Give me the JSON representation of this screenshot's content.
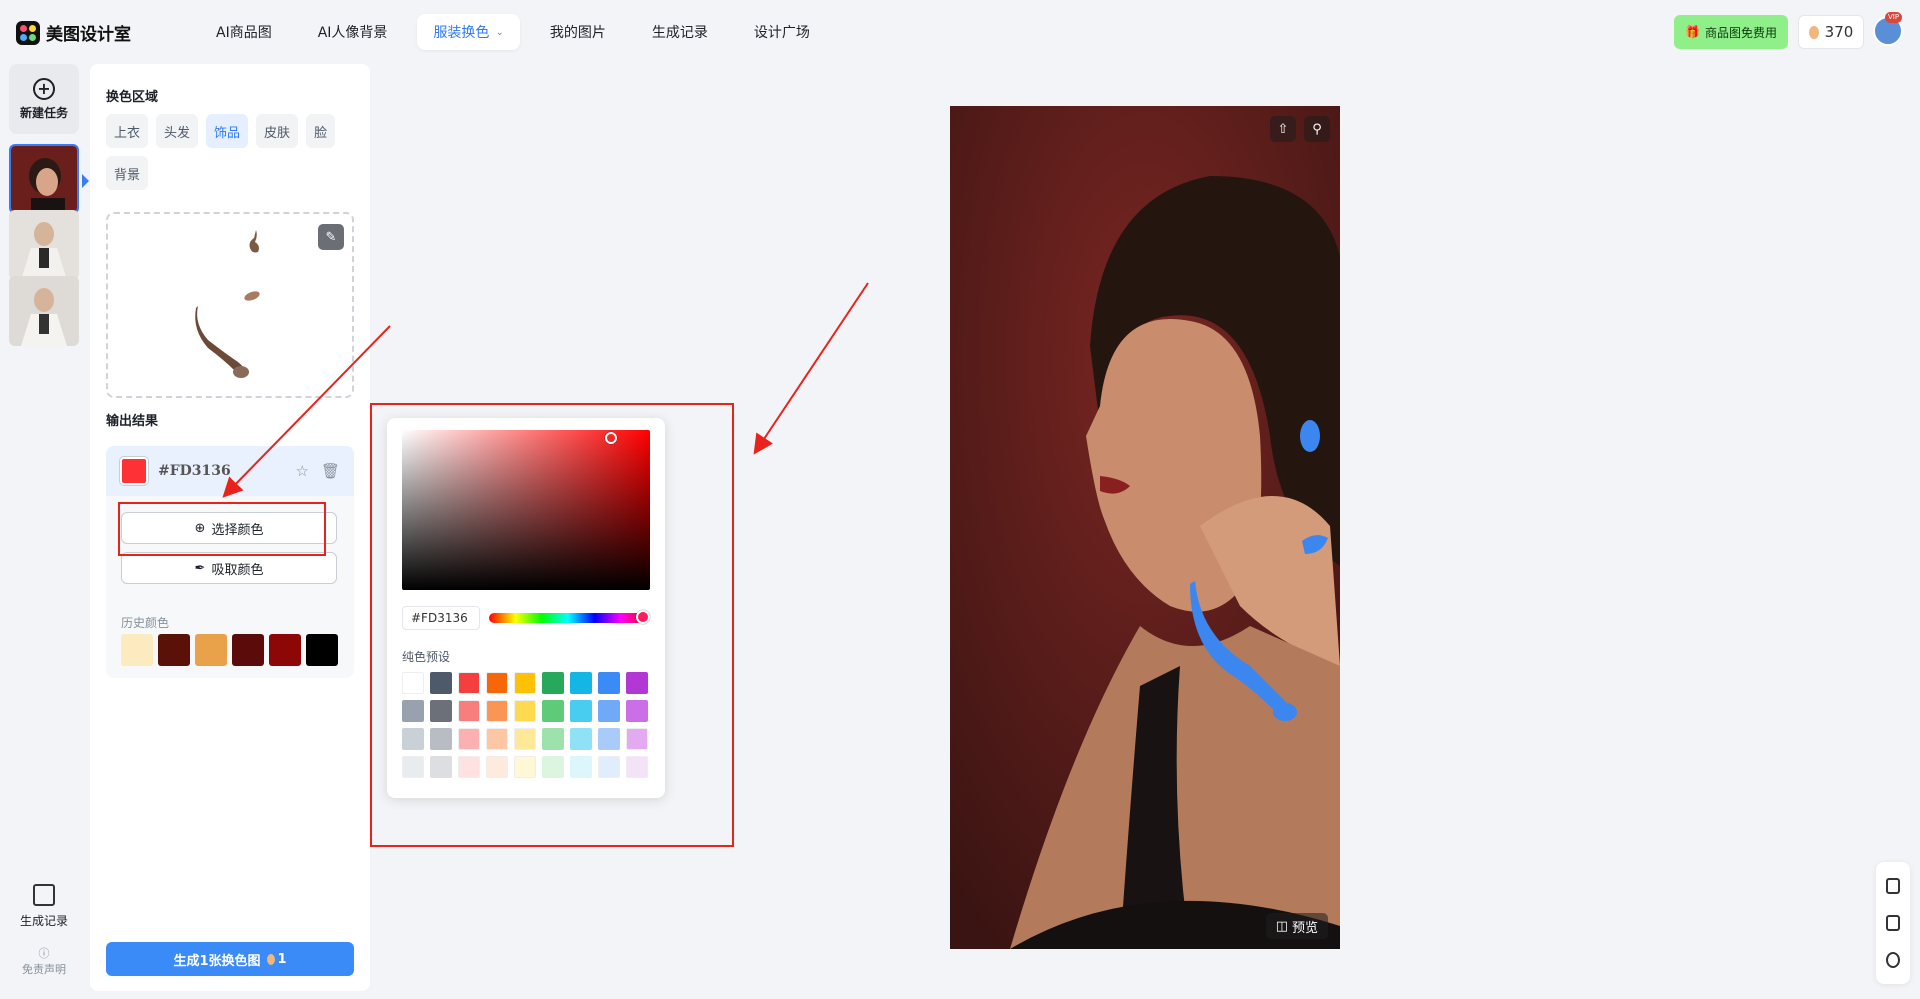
{
  "app": {
    "name": "美图设计室"
  },
  "nav": [
    {
      "label": "AI商品图"
    },
    {
      "label": "AI人像背景"
    },
    {
      "label": "服装换色",
      "active": true
    },
    {
      "label": "我的图片"
    },
    {
      "label": "生成记录"
    },
    {
      "label": "设计广场"
    }
  ],
  "topright": {
    "free_label": "商品图免费用",
    "credits": "370",
    "vip_badge": "VIP"
  },
  "rail": {
    "new_task": "新建任务",
    "history": "生成记录",
    "disclaimer": "免责声明"
  },
  "panel": {
    "region_title": "换色区域",
    "regions": [
      {
        "label": "上衣"
      },
      {
        "label": "头发"
      },
      {
        "label": "饰品",
        "active": true
      },
      {
        "label": "皮肤"
      },
      {
        "label": "脸"
      },
      {
        "label": "背景"
      }
    ],
    "output_title": "输出结果",
    "current_hex": "#FD3136",
    "pick_color": "选择颜色",
    "eyedropper": "吸取颜色",
    "history_label": "历史颜色",
    "history_colors": [
      "#FDEBC0",
      "#5A1208",
      "#E9A24A",
      "#5C0B0B",
      "#8E0707",
      "#000000"
    ],
    "generate_label": "生成1张换色图",
    "generate_cost": "1"
  },
  "picker": {
    "hex_value": "#FD3136",
    "preset_label": "纯色预设",
    "presets": [
      "#FFFFFF",
      "#4E5969",
      "#F53F3F",
      "#F76707",
      "#FFC107",
      "#27A85A",
      "#14B6E6",
      "#3A8AF7",
      "#B238D6",
      "#98A2AE",
      "#6B7079",
      "#F87D7D",
      "#FA9555",
      "#FFD950",
      "#5FCB78",
      "#48CDF0",
      "#6FA9F8",
      "#CC6FE6",
      "#C9D0D6",
      "#B8BDC3",
      "#FBB1B1",
      "#FCC7A2",
      "#FFE897",
      "#9DE2AA",
      "#8FE1F5",
      "#A9CBFA",
      "#E3A9F1",
      "#E8ECEF",
      "#DCDEE1",
      "#FEE1E0",
      "#FEEBDD",
      "#FFF7D6",
      "#DBF5DF",
      "#DDF6FC",
      "#E1EDFD",
      "#F4E2F8"
    ]
  },
  "preview": {
    "compare_label": "预览"
  },
  "colors": {
    "accent": "#2F7BF5",
    "annotation": "#E8231B",
    "selected": "#FD3136"
  }
}
